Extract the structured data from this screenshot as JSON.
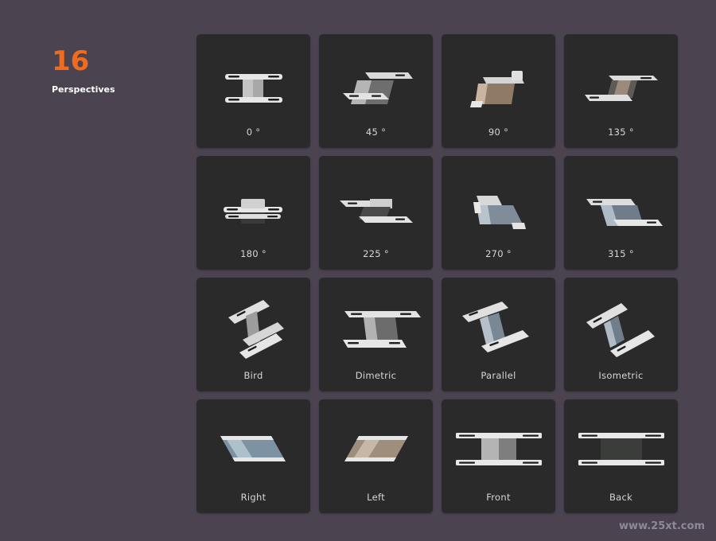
{
  "header": {
    "count": "16",
    "subtitle": "Perspectives"
  },
  "tiles": [
    {
      "label": "0 °",
      "icon": "stand-front-0-icon"
    },
    {
      "label": "45 °",
      "icon": "stand-45-icon"
    },
    {
      "label": "90 °",
      "icon": "stand-90-icon"
    },
    {
      "label": "135 °",
      "icon": "stand-135-icon"
    },
    {
      "label": "180 °",
      "icon": "stand-180-icon"
    },
    {
      "label": "225 °",
      "icon": "stand-225-icon"
    },
    {
      "label": "270 °",
      "icon": "stand-270-icon"
    },
    {
      "label": "315 °",
      "icon": "stand-315-icon"
    },
    {
      "label": "Bird",
      "icon": "stand-bird-icon"
    },
    {
      "label": "Dimetric",
      "icon": "stand-dimetric-icon"
    },
    {
      "label": "Parallel",
      "icon": "stand-parallel-icon"
    },
    {
      "label": "Isometric",
      "icon": "stand-isometric-icon"
    },
    {
      "label": "Right",
      "icon": "stand-right-icon"
    },
    {
      "label": "Left",
      "icon": "stand-left-icon"
    },
    {
      "label": "Front",
      "icon": "stand-front-icon"
    },
    {
      "label": "Back",
      "icon": "stand-back-icon"
    }
  ],
  "watermark": "www.25xt.com",
  "colors": {
    "background": "#4b4350",
    "tile": "#2a2a2b",
    "accent": "#f26b1d",
    "label": "#d6d6d6"
  }
}
